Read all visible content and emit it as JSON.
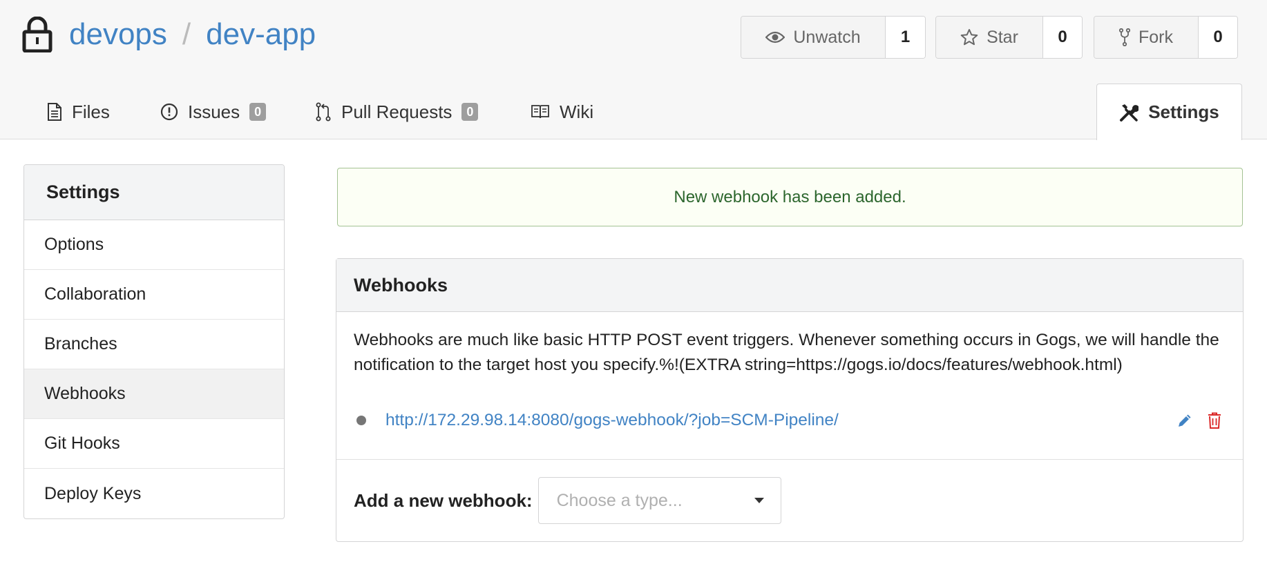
{
  "repo": {
    "owner": "devops",
    "separator": "/",
    "name": "dev-app"
  },
  "actions": {
    "watch": {
      "label": "Unwatch",
      "count": "1"
    },
    "star": {
      "label": "Star",
      "count": "0"
    },
    "fork": {
      "label": "Fork",
      "count": "0"
    }
  },
  "tabs": {
    "files": "Files",
    "issues": {
      "label": "Issues",
      "count": "0"
    },
    "pulls": {
      "label": "Pull Requests",
      "count": "0"
    },
    "wiki": "Wiki",
    "settings": "Settings"
  },
  "sidebar": {
    "header": "Settings",
    "items": [
      "Options",
      "Collaboration",
      "Branches",
      "Webhooks",
      "Git Hooks",
      "Deploy Keys"
    ],
    "active": "Webhooks"
  },
  "alert": {
    "message": "New webhook has been added."
  },
  "webhooks": {
    "title": "Webhooks",
    "description": "Webhooks are much like basic HTTP POST event triggers. Whenever something occurs in Gogs, we will handle the notification to the target host you specify.%!(EXTRA string=https://gogs.io/docs/features/webhook.html)",
    "hooks": [
      {
        "url": "http://172.29.98.14:8080/gogs-webhook/?job=SCM-Pipeline/",
        "status_color": "#767676"
      }
    ],
    "add_label": "Add a new webhook:",
    "type_placeholder": "Choose a type..."
  },
  "colors": {
    "link": "#4183c4",
    "success_text": "#2c662d",
    "success_border": "#a3c293",
    "delete": "#db2828"
  },
  "icons": [
    "lock-icon",
    "eye-icon",
    "star-icon",
    "fork-icon",
    "file-icon",
    "issue-icon",
    "pull-request-icon",
    "book-icon",
    "tools-icon",
    "pencil-icon",
    "trash-icon",
    "dropdown-caret-icon"
  ]
}
